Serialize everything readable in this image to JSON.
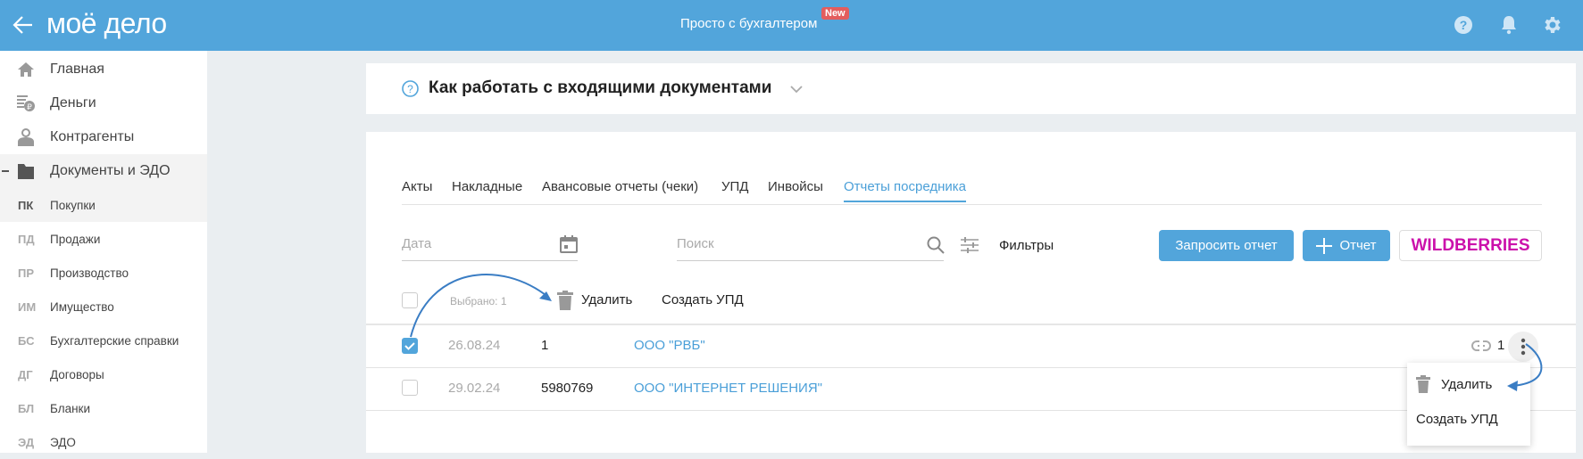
{
  "header": {
    "logo": "моё дело",
    "center_title": "Просто с бухгалтером",
    "badge": "New"
  },
  "sidebar": {
    "items": [
      {
        "label": "Главная",
        "icon": "home-icon"
      },
      {
        "label": "Деньги",
        "icon": "money-icon"
      },
      {
        "label": "Контрагенты",
        "icon": "contractors-icon"
      },
      {
        "label": "Документы и ЭДО",
        "icon": "folder-icon"
      }
    ],
    "subitems": [
      {
        "abbr": "ПК",
        "label": "Покупки"
      },
      {
        "abbr": "ПД",
        "label": "Продажи"
      },
      {
        "abbr": "ПР",
        "label": "Производство"
      },
      {
        "abbr": "ИМ",
        "label": "Имущество"
      },
      {
        "abbr": "БС",
        "label": "Бухгалтерские справки"
      },
      {
        "abbr": "ДГ",
        "label": "Договоры"
      },
      {
        "abbr": "БЛ",
        "label": "Бланки"
      },
      {
        "abbr": "ЭД",
        "label": "ЭДО"
      }
    ]
  },
  "help": {
    "title": "Как работать с входящими документами"
  },
  "tabs": [
    "Акты",
    "Накладные",
    "Авансовые отчеты (чеки)",
    "УПД",
    "Инвойсы",
    "Отчеты посредника"
  ],
  "filters": {
    "date_placeholder": "Дата",
    "search_placeholder": "Поиск",
    "filters_label": "Фильтры"
  },
  "buttons": {
    "request": "Запросить отчет",
    "add": "Отчет",
    "wildberries": "WILDBERRIES"
  },
  "bulk": {
    "selected": "Выбрано: 1",
    "delete": "Удалить",
    "create_upd": "Создать УПД"
  },
  "rows": [
    {
      "checked": true,
      "date": "26.08.24",
      "number": "1",
      "company": "ООО \"РВБ\"",
      "links": "1"
    },
    {
      "checked": false,
      "date": "29.02.24",
      "number": "5980769",
      "company": "ООО \"ИНТЕРНЕТ РЕШЕНИЯ\""
    }
  ],
  "menu": {
    "delete": "Удалить",
    "create_upd": "Создать УПД"
  },
  "colors": {
    "brand": "#52a5db",
    "badge": "#e35d5d",
    "wildberries": "#cb11ab"
  }
}
